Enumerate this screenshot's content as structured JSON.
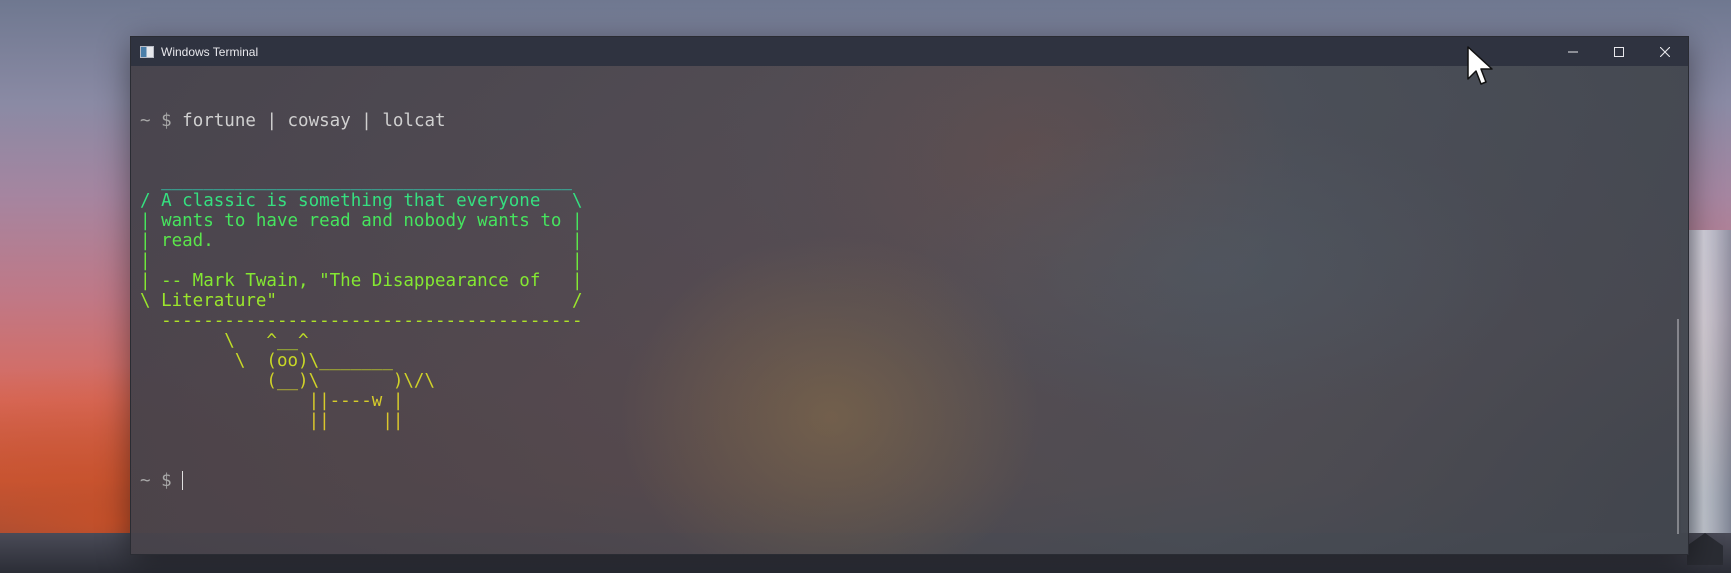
{
  "window": {
    "title": "Windows Terminal",
    "controls": [
      "minimize",
      "maximize",
      "close"
    ]
  },
  "terminal": {
    "command_line": {
      "prompt": "~ $",
      "command": "fortune | cowsay | lolcat"
    },
    "output_lines": [
      {
        "text": "  _______________________________________",
        "color": "#2ed9b8"
      },
      {
        "text": "/ A classic is something that everyone   \\",
        "color": "#35e080"
      },
      {
        "text": "| wants to have read and nobody wants to |",
        "color": "#46e45e"
      },
      {
        "text": "| read.                                  |",
        "color": "#5be64a"
      },
      {
        "text": "|                                        |",
        "color": "#6ee83c"
      },
      {
        "text": "| -- Mark Twain, \"The Disappearance of   |",
        "color": "#84e832"
      },
      {
        "text": "\\ Literature\"                            /",
        "color": "#9ae62c"
      },
      {
        "text": "  ----------------------------------------",
        "color": "#aee428"
      },
      {
        "text": "        \\   ^__^",
        "color": "#bede26"
      },
      {
        "text": "         \\  (oo)\\_______",
        "color": "#c8d826"
      },
      {
        "text": "            (__)\\       )\\/\\",
        "color": "#d0d228"
      },
      {
        "text": "                ||----w |",
        "color": "#d6cc2a"
      },
      {
        "text": "                ||     ||",
        "color": "#dac62c"
      }
    ],
    "current_prompt": "~ $ "
  },
  "colors": {
    "titlebar": "#2f3340",
    "terminal_background": "#4a4650",
    "prompt_text": "#d0d0d0"
  }
}
